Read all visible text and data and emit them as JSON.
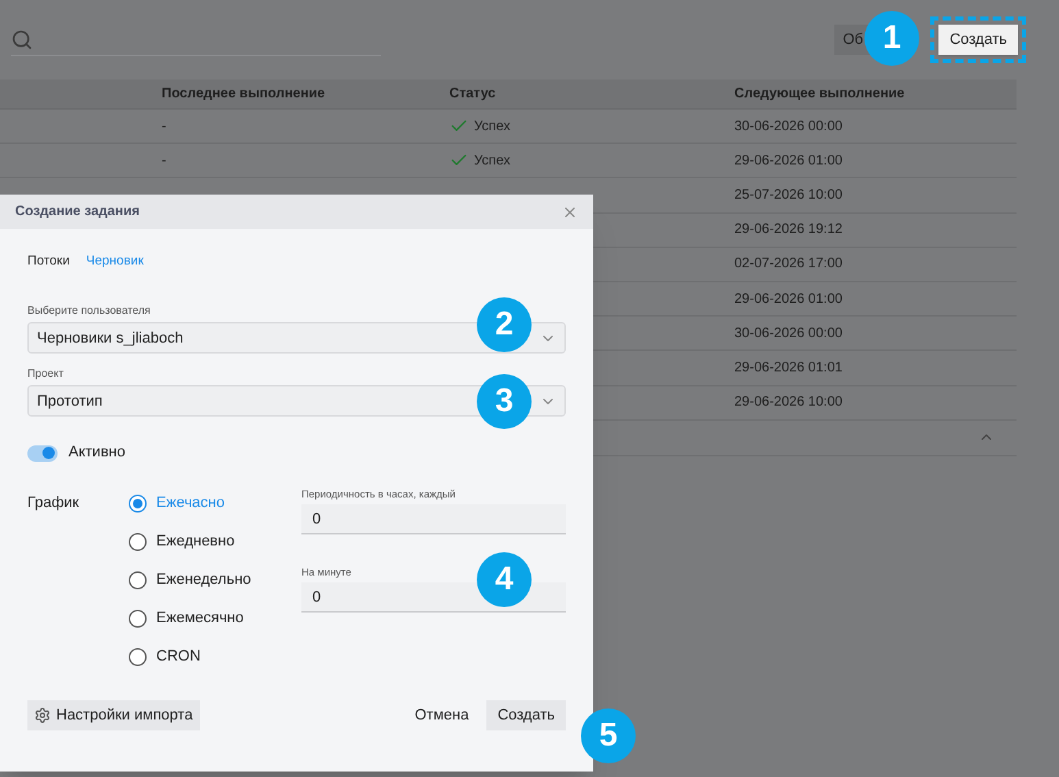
{
  "toolbar": {
    "buttons": [
      {
        "label": "Об",
        "highlighted": false
      },
      {
        "label": "Создать",
        "highlighted": true
      }
    ]
  },
  "table": {
    "columns": [
      "Последнее выполнение",
      "Статус",
      "Следующее выполнение"
    ],
    "rows": [
      {
        "last": "-",
        "status": "Успех",
        "kind": "success",
        "next": "30-06-2026 00:00"
      },
      {
        "last": "-",
        "status": "Успех",
        "kind": "success",
        "next": "29-06-2026 01:00"
      },
      {
        "next": "25-07-2026 10:00"
      },
      {
        "next": "29-06-2026 19:12"
      },
      {
        "next": "02-07-2026 17:00"
      },
      {
        "next": "29-06-2026 01:00"
      },
      {
        "next": "30-06-2026 00:00"
      },
      {
        "next": "29-06-2026 01:01"
      },
      {
        "next": "29-06-2026 10:00"
      }
    ]
  },
  "dialog": {
    "title": "Создание задания",
    "tabs": [
      {
        "label": "Потоки",
        "selected": false
      },
      {
        "label": "Черновик",
        "selected": true
      }
    ],
    "user_select": {
      "label": "Выберите пользователя",
      "value": "Черновики s_jliaboch"
    },
    "project_select": {
      "label": "Проект",
      "value": "Прототип"
    },
    "active_toggle": {
      "label": "Активно",
      "on": true
    },
    "schedule": {
      "label": "График",
      "options": [
        {
          "label": "Ежечасно",
          "selected": true
        },
        {
          "label": "Ежедневно",
          "selected": false
        },
        {
          "label": "Еженедельно",
          "selected": false
        },
        {
          "label": "Ежемесячно",
          "selected": false
        },
        {
          "label": "CRON",
          "selected": false
        }
      ],
      "fields": [
        {
          "label": "Периодичность в часах, каждый",
          "value": "0"
        },
        {
          "label": "На минуте",
          "value": "0"
        }
      ]
    },
    "import_button": "Настройки импорта",
    "cancel_button": "Отмена",
    "create_button": "Создать"
  },
  "callouts": [
    "1",
    "2",
    "3",
    "4",
    "5"
  ]
}
